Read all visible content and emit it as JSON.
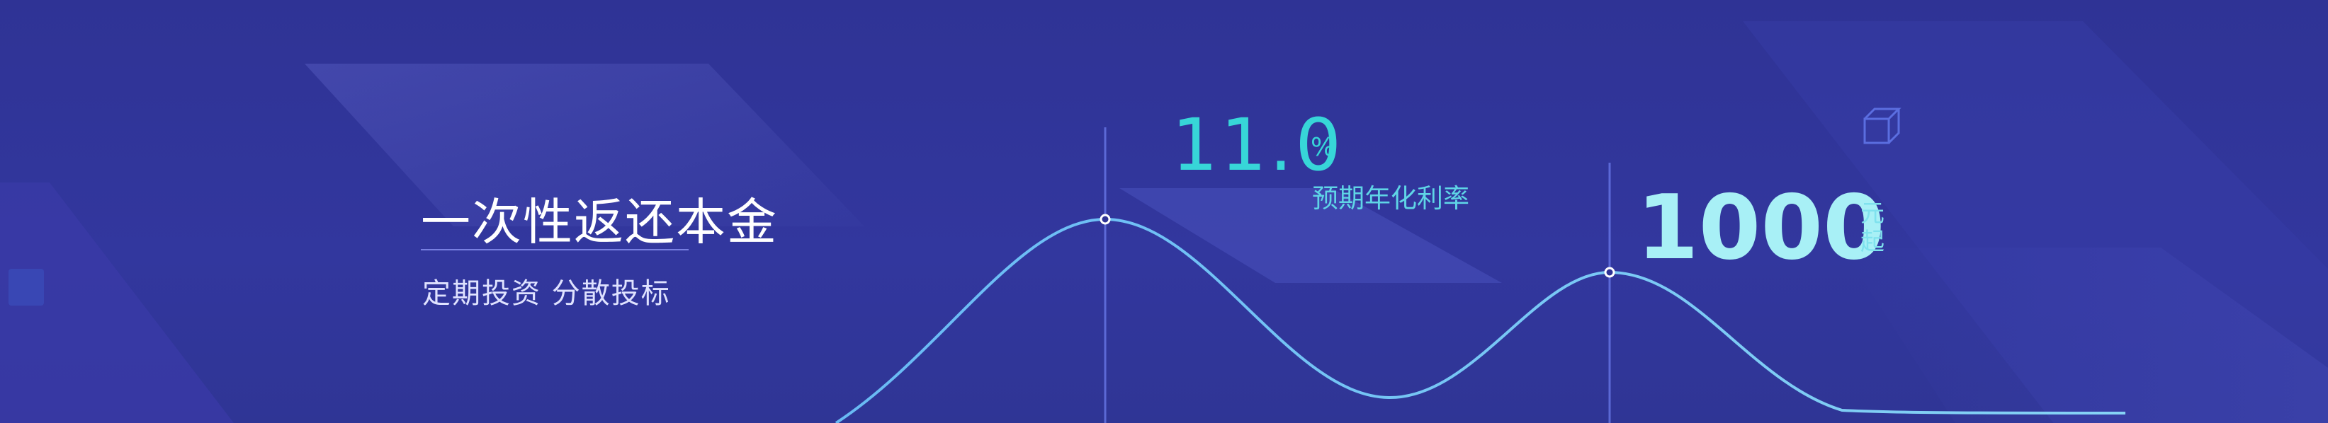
{
  "banner": {
    "headline": "一次性返还本金",
    "subline": "定期投资  分散投标",
    "rate": {
      "value": "11.0",
      "unit": "%",
      "caption": "预期年化利率"
    },
    "amount": {
      "value": "1000",
      "unit_line1": "元",
      "unit_line2": "起"
    }
  },
  "colors": {
    "background": "#30349a",
    "accent_cyan": "#37d6d8",
    "amount_text": "#a8f0f6",
    "curve": "#7fd0ff"
  },
  "icons": [
    "cube-outline-icon",
    "cube-corner-icon"
  ]
}
